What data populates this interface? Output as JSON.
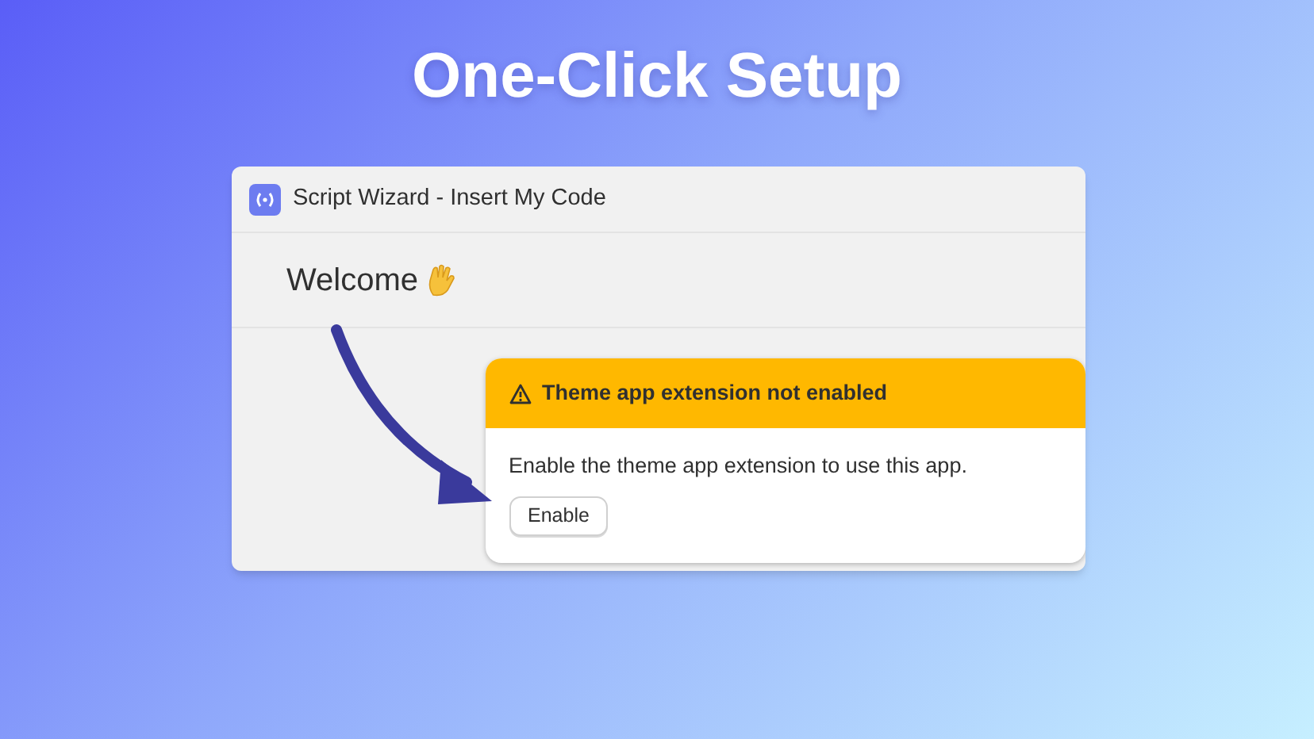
{
  "headline": "One-Click Setup",
  "window": {
    "title": "Script Wizard - Insert My Code"
  },
  "page": {
    "heading": "Welcome"
  },
  "banner": {
    "title": "Theme app extension not enabled",
    "message": "Enable the theme app extension to use this app.",
    "button": "Enable"
  }
}
